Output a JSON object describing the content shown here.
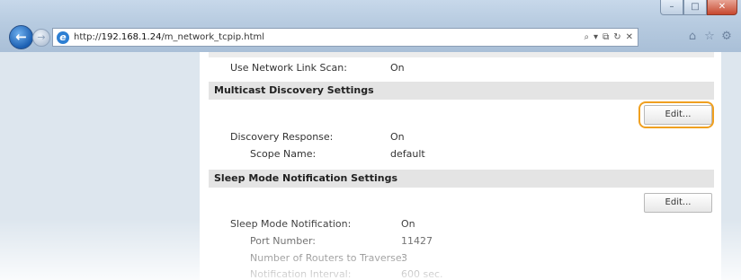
{
  "browser": {
    "url_prefix": "http://",
    "url_host": "192.168.1.24",
    "url_path": "/m_network_tcpip.html",
    "address_icons": [
      "search-icon",
      "dropdown-icon",
      "compat-icon",
      "refresh-icon",
      "stop-icon"
    ],
    "address_glyphs": {
      "search": "⌕",
      "dropdown": "▾",
      "compat": "⧉",
      "refresh": "↻",
      "stop": "✕"
    },
    "toolbar_glyphs": {
      "home": "⌂",
      "favorites": "☆",
      "tools": "⚙"
    },
    "nav_glyphs": {
      "back": "←",
      "forward": "→",
      "ie": "e"
    },
    "window_glyphs": {
      "minimize": "–",
      "maximize": "□",
      "close": "✕"
    }
  },
  "settings": {
    "network_link_scan": {
      "label": "Use Network Link Scan:",
      "value": "On"
    },
    "multicast": {
      "title": "Multicast Discovery Settings",
      "edit_label": "Edit...",
      "rows": [
        {
          "label": "Discovery Response:",
          "value": "On"
        },
        {
          "label": "Scope Name:",
          "value": "default"
        }
      ]
    },
    "sleep": {
      "title": "Sleep Mode Notification Settings",
      "edit_label": "Edit...",
      "rows": [
        {
          "label": "Sleep Mode Notification:",
          "value": "On"
        },
        {
          "label": "Port Number:",
          "value": "11427"
        },
        {
          "label": "Number of Routers to Traverse:",
          "value": "3"
        },
        {
          "label": "Notification Interval:",
          "value": "600 sec."
        }
      ]
    }
  },
  "colors": {
    "highlight": "#f0a020",
    "section_header": "#e4e4e4",
    "side_panel": "#dde6ee"
  }
}
